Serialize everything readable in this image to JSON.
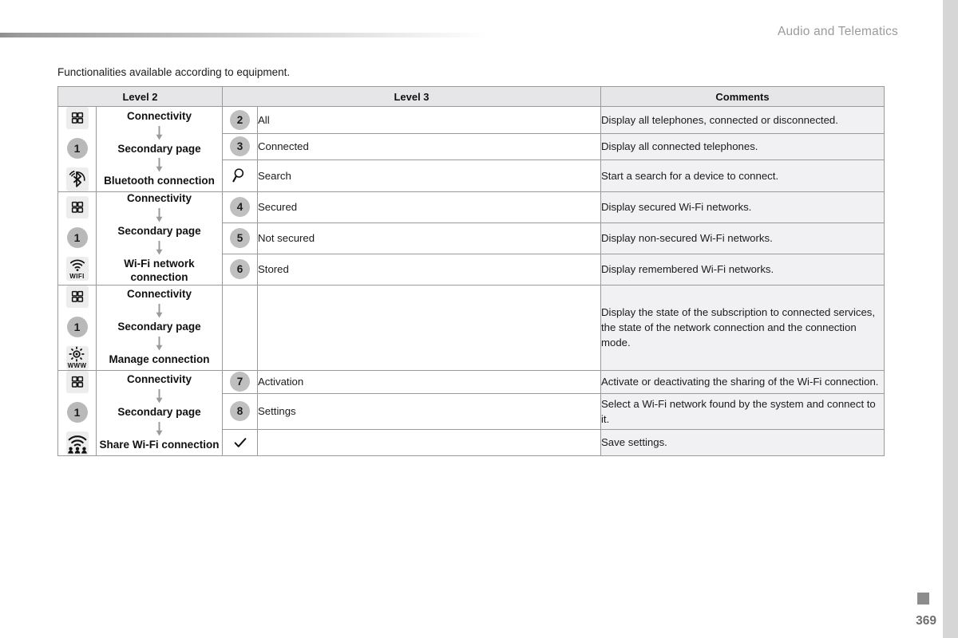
{
  "header": {
    "running_title": "Audio and Telematics"
  },
  "intro": {
    "text": "Functionalities available according to equipment."
  },
  "table": {
    "columns": {
      "level2": "Level 2",
      "level3": "Level 3",
      "comments": "Comments"
    },
    "groups": [
      {
        "id": "bluetooth-connection",
        "icons": [
          {
            "name": "apps-grid-icon",
            "kind": "grid"
          },
          {
            "name": "step-1-badge",
            "kind": "circle-number",
            "value": "1"
          },
          {
            "name": "bluetooth-icon",
            "kind": "bluetooth"
          }
        ],
        "path": [
          "Connectivity",
          "Secondary page",
          "Bluetooth connection"
        ],
        "rows": [
          {
            "marker": {
              "kind": "number",
              "value": "2",
              "name": "step-2-badge"
            },
            "label": "All",
            "comment": "Display all telephones, connected or disconnected."
          },
          {
            "marker": {
              "kind": "number",
              "value": "3",
              "name": "step-3-badge"
            },
            "label": "Connected",
            "comment": "Display all connected telephones."
          },
          {
            "marker": {
              "kind": "search",
              "value": "",
              "name": "search-icon"
            },
            "label": "Search",
            "comment": "Start a search for a device to connect."
          }
        ]
      },
      {
        "id": "wifi-network-connection",
        "icons": [
          {
            "name": "apps-grid-icon",
            "kind": "grid"
          },
          {
            "name": "step-1-badge",
            "kind": "circle-number",
            "value": "1"
          },
          {
            "name": "wifi-icon",
            "kind": "wifi",
            "caption": "WIFI"
          }
        ],
        "path": [
          "Connectivity",
          "Secondary page",
          "Wi-Fi network connection"
        ],
        "rows": [
          {
            "marker": {
              "kind": "number",
              "value": "4",
              "name": "step-4-badge"
            },
            "label": "Secured",
            "comment": "Display secured Wi-Fi networks."
          },
          {
            "marker": {
              "kind": "number",
              "value": "5",
              "name": "step-5-badge"
            },
            "label": "Not secured",
            "comment": "Display non-secured Wi-Fi networks."
          },
          {
            "marker": {
              "kind": "number",
              "value": "6",
              "name": "step-6-badge"
            },
            "label": "Stored",
            "comment": "Display remembered Wi-Fi networks."
          }
        ]
      },
      {
        "id": "manage-connection",
        "icons": [
          {
            "name": "apps-grid-icon",
            "kind": "grid"
          },
          {
            "name": "step-1-badge",
            "kind": "circle-number",
            "value": "1"
          },
          {
            "name": "www-gear-icon",
            "kind": "gear-www",
            "caption": "WWW"
          }
        ],
        "path": [
          "Connectivity",
          "Secondary page",
          "Manage connection"
        ],
        "rows": [
          {
            "marker": {
              "kind": "none",
              "value": "",
              "name": "no-marker"
            },
            "label": "",
            "comment": "Display the state of the subscription to connected services, the state of the network connection and the connection mode."
          }
        ]
      },
      {
        "id": "share-wifi-connection",
        "icons": [
          {
            "name": "apps-grid-icon",
            "kind": "grid"
          },
          {
            "name": "step-1-badge",
            "kind": "circle-number",
            "value": "1"
          },
          {
            "name": "share-wifi-icon",
            "kind": "share-wifi"
          }
        ],
        "path": [
          "Connectivity",
          "Secondary page",
          "Share Wi-Fi connection"
        ],
        "rows": [
          {
            "marker": {
              "kind": "number",
              "value": "7",
              "name": "step-7-badge"
            },
            "label": "Activation",
            "comment": "Activate or deactivating the sharing of the Wi-Fi connection."
          },
          {
            "marker": {
              "kind": "number",
              "value": "8",
              "name": "step-8-badge"
            },
            "label": "Settings",
            "comment": "Select a Wi-Fi network found by the system and connect to it."
          },
          {
            "marker": {
              "kind": "check",
              "value": "",
              "name": "check-icon"
            },
            "label": "",
            "comment": "Save settings."
          }
        ]
      }
    ]
  },
  "footer": {
    "page_number": "369"
  },
  "colors": {
    "edge_strip": "#d6d6d6",
    "header_fill": "#e6e6e8",
    "comment_fill": "#f1f1f3",
    "badge_fill": "#bfbfbf",
    "border": "#9a9a9a",
    "running_header_text": "#9b9b9b"
  }
}
